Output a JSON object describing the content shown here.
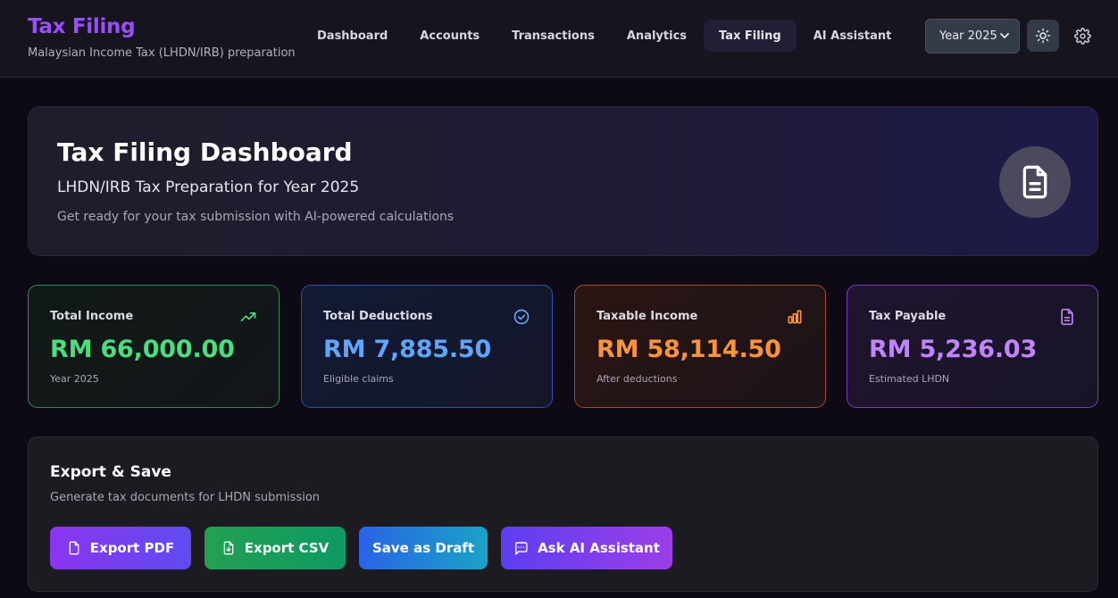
{
  "header": {
    "title": "Tax Filing",
    "subtitle": "Malaysian Income Tax (LHDN/IRB) preparation",
    "nav": [
      {
        "label": "Dashboard"
      },
      {
        "label": "Accounts"
      },
      {
        "label": "Transactions"
      },
      {
        "label": "Analytics"
      },
      {
        "label": "Tax Filing",
        "active": true
      },
      {
        "label": "AI Assistant"
      }
    ],
    "year_select": "Year 2025",
    "icons": {
      "theme": "sun-icon",
      "settings": "gear-icon"
    }
  },
  "hero": {
    "title": "Tax Filing Dashboard",
    "subtitle": "LHDN/IRB Tax Preparation for Year 2025",
    "description": "Get ready for your tax submission with AI-powered calculations",
    "icon": "document-icon"
  },
  "stats": [
    {
      "label": "Total Income",
      "value": "RM 66,000.00",
      "note": "Year 2025",
      "icon": "trending-up-icon",
      "color": "#4ade80"
    },
    {
      "label": "Total Deductions",
      "value": "RM 7,885.50",
      "note": "Eligible claims",
      "icon": "check-circle-icon",
      "color": "#60a5fa"
    },
    {
      "label": "Taxable Income",
      "value": "RM 58,114.50",
      "note": "After deductions",
      "icon": "bar-chart-icon",
      "color": "#fb923c"
    },
    {
      "label": "Tax Payable",
      "value": "RM 5,236.03",
      "note": "Estimated LHDN",
      "icon": "document-icon",
      "color": "#c084fc"
    }
  ],
  "export": {
    "title": "Export & Save",
    "subtitle": "Generate tax documents for LHDN submission",
    "buttons": [
      {
        "label": "Export PDF",
        "icon": "file-icon"
      },
      {
        "label": "Export CSV",
        "icon": "file-download-icon"
      },
      {
        "label": "Save as Draft"
      },
      {
        "label": "Ask AI Assistant",
        "icon": "chat-icon"
      }
    ]
  }
}
